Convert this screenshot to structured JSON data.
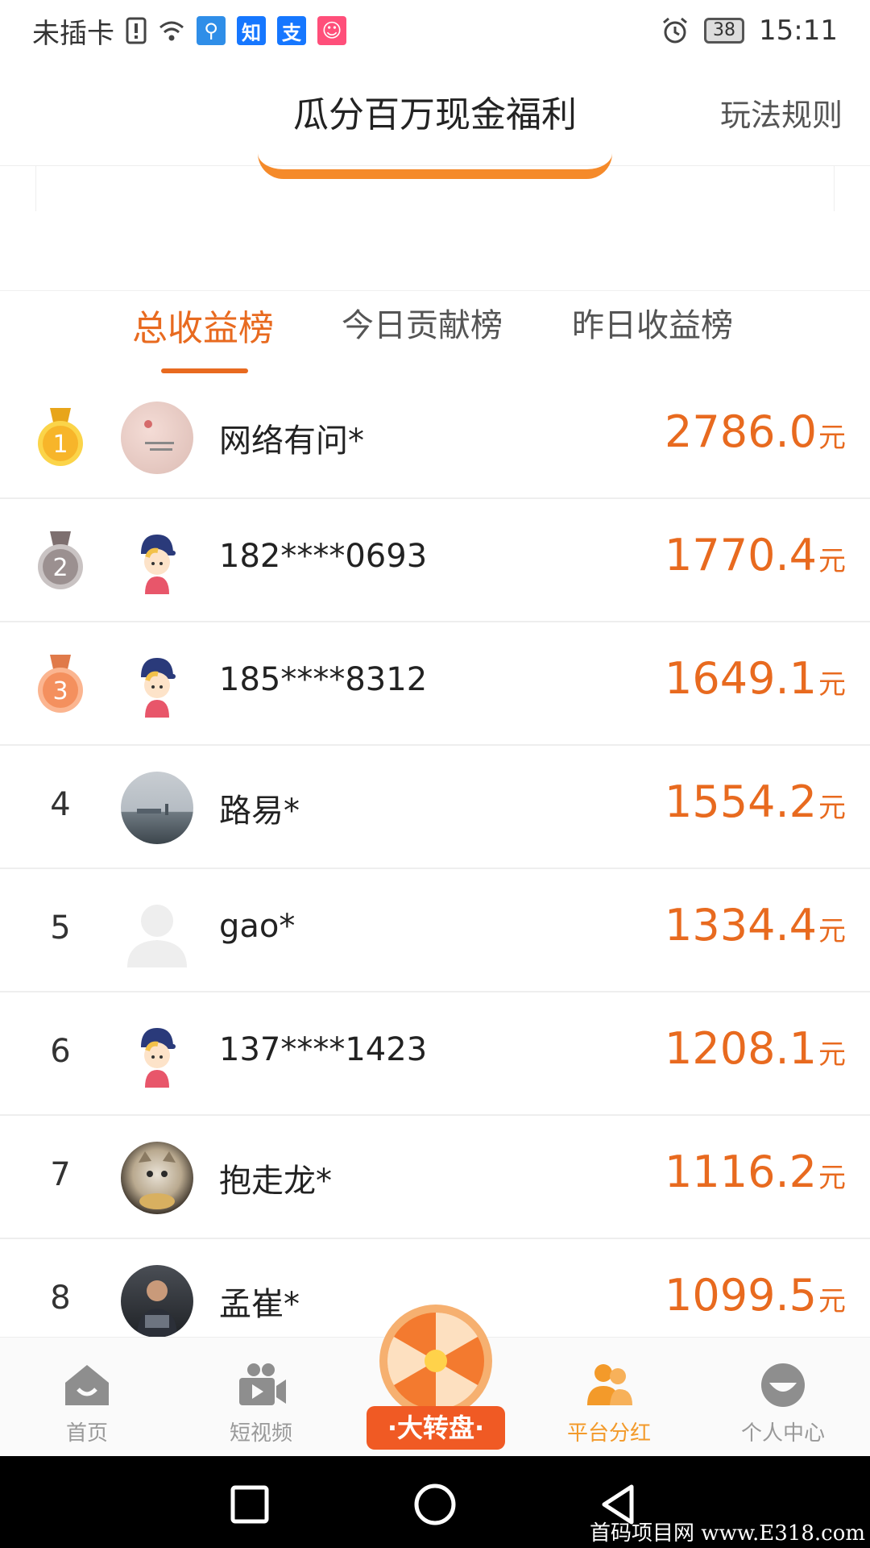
{
  "status_bar": {
    "carrier": "未插卡",
    "apps": [
      "知",
      "支"
    ],
    "battery": "38",
    "time": "15:11"
  },
  "header": {
    "title": "瓜分百万现金福利",
    "rules": "玩法规则"
  },
  "tabs": [
    {
      "label": "总收益榜"
    },
    {
      "label": "今日贡献榜"
    },
    {
      "label": "昨日收益榜"
    }
  ],
  "ranking": [
    {
      "rank": "1",
      "name": "网络有问*",
      "amount": "2786.0",
      "unit": "元"
    },
    {
      "rank": "2",
      "name": "182****0693",
      "amount": "1770.4",
      "unit": "元"
    },
    {
      "rank": "3",
      "name": "185****8312",
      "amount": "1649.1",
      "unit": "元"
    },
    {
      "rank": "4",
      "name": "路易*",
      "amount": "1554.2",
      "unit": "元"
    },
    {
      "rank": "5",
      "name": "gao*",
      "amount": "1334.4",
      "unit": "元"
    },
    {
      "rank": "6",
      "name": "137****1423",
      "amount": "1208.1",
      "unit": "元"
    },
    {
      "rank": "7",
      "name": "抱走龙*",
      "amount": "1116.2",
      "unit": "元"
    },
    {
      "rank": "8",
      "name": "孟崔*",
      "amount": "1099.5",
      "unit": "元"
    }
  ],
  "bottom_nav": {
    "home": "首页",
    "video": "短视频",
    "wheel": "·大转盘·",
    "dividend": "平台分红",
    "profile": "个人中心"
  },
  "watermark": "首码项目网 www.E318.com",
  "colors": {
    "accent": "#e86a1f",
    "nav_active": "#f39a2a",
    "wheel": "#f05a24"
  }
}
